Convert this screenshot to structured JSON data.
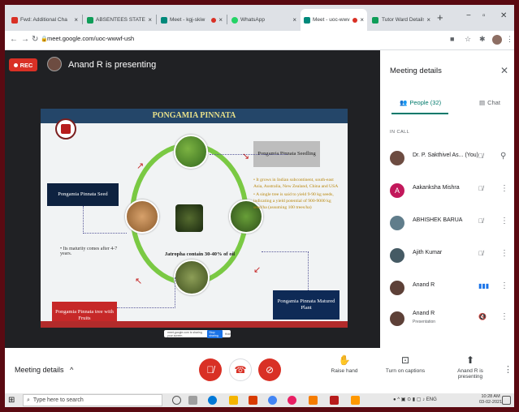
{
  "browser": {
    "tabs": [
      {
        "title": "Fwd: Additional Cha",
        "favicon": "gmail-icon",
        "color": "#d93025",
        "active": false
      },
      {
        "title": "ABSENTEES STATEM",
        "favicon": "sheets-icon",
        "color": "#0f9d58",
        "active": false
      },
      {
        "title": "Meet - kgj-skiw",
        "favicon": "meet-icon",
        "color": "#00897b",
        "active": false,
        "recording": true
      },
      {
        "title": "WhatsApp",
        "favicon": "whatsapp-icon",
        "color": "#25d366",
        "active": false
      },
      {
        "title": "Meet - uoc-wwv",
        "favicon": "meet-icon",
        "color": "#00897b",
        "active": true,
        "recording": true
      },
      {
        "title": "Tutor Ward Details",
        "favicon": "sheets-icon",
        "color": "#0f9d58",
        "active": false
      }
    ],
    "url": "meet.google.com/uoc-wwwf-ush"
  },
  "meet": {
    "rec_label": "REC",
    "presenter_text": "Anand R is presenting"
  },
  "slide": {
    "title": "PONGAMIA PINNATA",
    "seed_label": "Pongamia Pinnata Seed",
    "seedling_label": "Pongamia Pinnata Seedling",
    "tree_label": "Pongamia Pinnata tree with Fruits",
    "mature_label": "Pongamia Pinnata Matured Plant",
    "center_text": "Jatropha contain 30-40% of oil",
    "left_bullet": "Its maturity comes after 4-7 years.",
    "right_bullets": [
      "It grows in Indian subcontinent, south-east Asia, Australia, New Zealand, China and USA",
      "A single tree is said to yield 9-90 kg seeds, indicating a yield potential of 900-9000 kg seed/ha (assuming 100 trees/ha)"
    ]
  },
  "share_bar": {
    "text": "meet.google.com is sharing your screen.",
    "stop_label": "Stop sharing",
    "hide_label": "Hide"
  },
  "panel": {
    "title": "Meeting details",
    "people_tab": "People (32)",
    "chat_tab": "Chat",
    "in_call_label": "IN CALL",
    "participants": [
      {
        "name": "Dr. P. Sakthivel As...",
        "suffix": "(You)",
        "sub": "",
        "avatar_type": "photo",
        "color": "#6d4c41",
        "mic": "muted",
        "action": "pin"
      },
      {
        "name": "Aakanksha Mishra",
        "sub": "",
        "avatar_type": "letter",
        "letter": "A",
        "color": "#c2185b",
        "mic": "muted",
        "action": "more"
      },
      {
        "name": "ABHISHEK BARUA",
        "sub": "",
        "avatar_type": "photo",
        "color": "#607d8b",
        "mic": "muted",
        "action": "more"
      },
      {
        "name": "Ajith Kumar",
        "sub": "",
        "avatar_type": "photo",
        "color": "#455a64",
        "mic": "muted",
        "action": "more"
      },
      {
        "name": "Anand R",
        "sub": "",
        "avatar_type": "photo",
        "color": "#5d4037",
        "mic": "speaking",
        "action": "more"
      },
      {
        "name": "Anand R",
        "sub": "Presentation",
        "avatar_type": "photo",
        "color": "#5d4037",
        "mic": "presenting",
        "action": "more"
      }
    ]
  },
  "controls": {
    "meeting_details_label": "Meeting details",
    "raise_hand_label": "Raise hand",
    "captions_label": "Turn on captions",
    "presenting_label": "Anand R is presenting"
  },
  "taskbar": {
    "search_placeholder": "Type here to search",
    "lang": "ENG",
    "time": "10:28 AM",
    "date": "03-02-2021"
  }
}
